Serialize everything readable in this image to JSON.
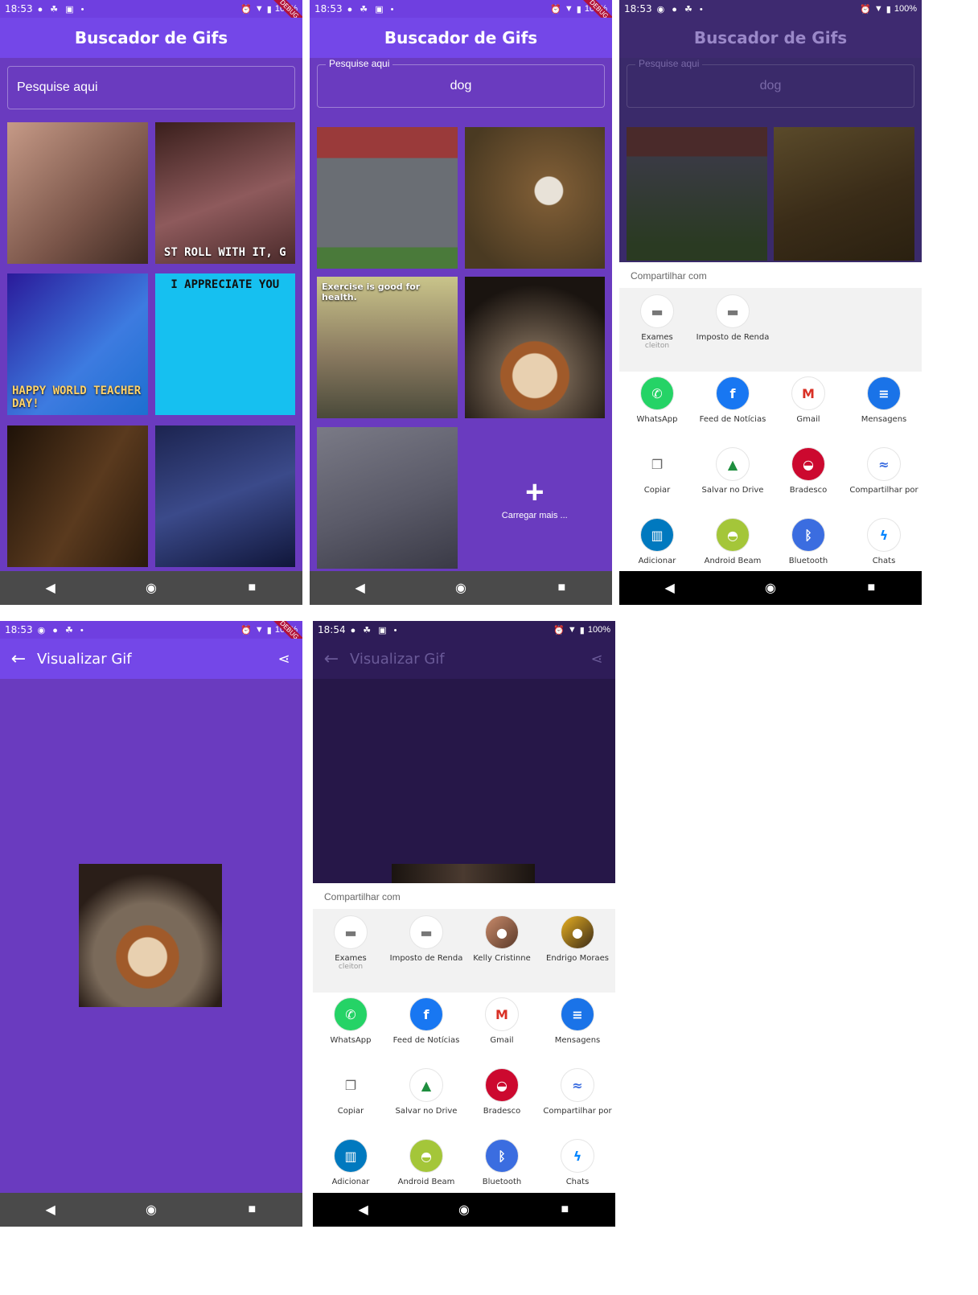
{
  "status_bar": {
    "time_a": "18:53",
    "time_b": "18:54",
    "battery": "100%",
    "debug_badge": "DEBUG"
  },
  "search_screen": {
    "title": "Buscador de Gifs",
    "search_placeholder": "Pesquise aqui",
    "search_value": "dog",
    "load_more": "Carregar mais ...",
    "trending_captions": [
      "",
      "ST ROLL WITH IT, G",
      "HAPPY WORLD TEACHER DAY!",
      "I APPRECIATE YOU",
      "",
      ""
    ],
    "dog_captions": [
      "",
      "",
      "Exercise is good for health.",
      "",
      ""
    ]
  },
  "gif_screen": {
    "title": "Visualizar Gif"
  },
  "share_sheet": {
    "header": "Compartilhar com",
    "direct_short": [
      {
        "label": "Exames",
        "sub": "cleiton"
      },
      {
        "label": "Imposto de Renda",
        "sub": ""
      }
    ],
    "direct_long": [
      {
        "label": "Exames",
        "sub": "cleiton"
      },
      {
        "label": "Imposto de Renda",
        "sub": ""
      },
      {
        "label": "Kelly Cristinne",
        "sub": ""
      },
      {
        "label": "Endrigo Moraes",
        "sub": ""
      }
    ],
    "apps": [
      {
        "label": "WhatsApp",
        "color": "#25d366"
      },
      {
        "label": "Feed de Notícias",
        "color": "#1877f2"
      },
      {
        "label": "Gmail",
        "color": "#ffffff"
      },
      {
        "label": "Mensagens",
        "color": "#1a73e8"
      },
      {
        "label": "Copiar",
        "color": "#ffffff"
      },
      {
        "label": "Salvar no Drive",
        "color": "#ffffff"
      },
      {
        "label": "Bradesco",
        "color": "#cc092f"
      },
      {
        "label": "Compartilhar por",
        "color": "#ffffff"
      },
      {
        "label": "Adicionar",
        "color": "#0079bf"
      },
      {
        "label": "Android Beam",
        "color": "#a4c639"
      },
      {
        "label": "Bluetooth",
        "color": "#3b6de0"
      },
      {
        "label": "Chats",
        "color": "#0084ff"
      }
    ]
  },
  "colors": {
    "primary": "#7447e8",
    "background": "#6a3bbf"
  }
}
